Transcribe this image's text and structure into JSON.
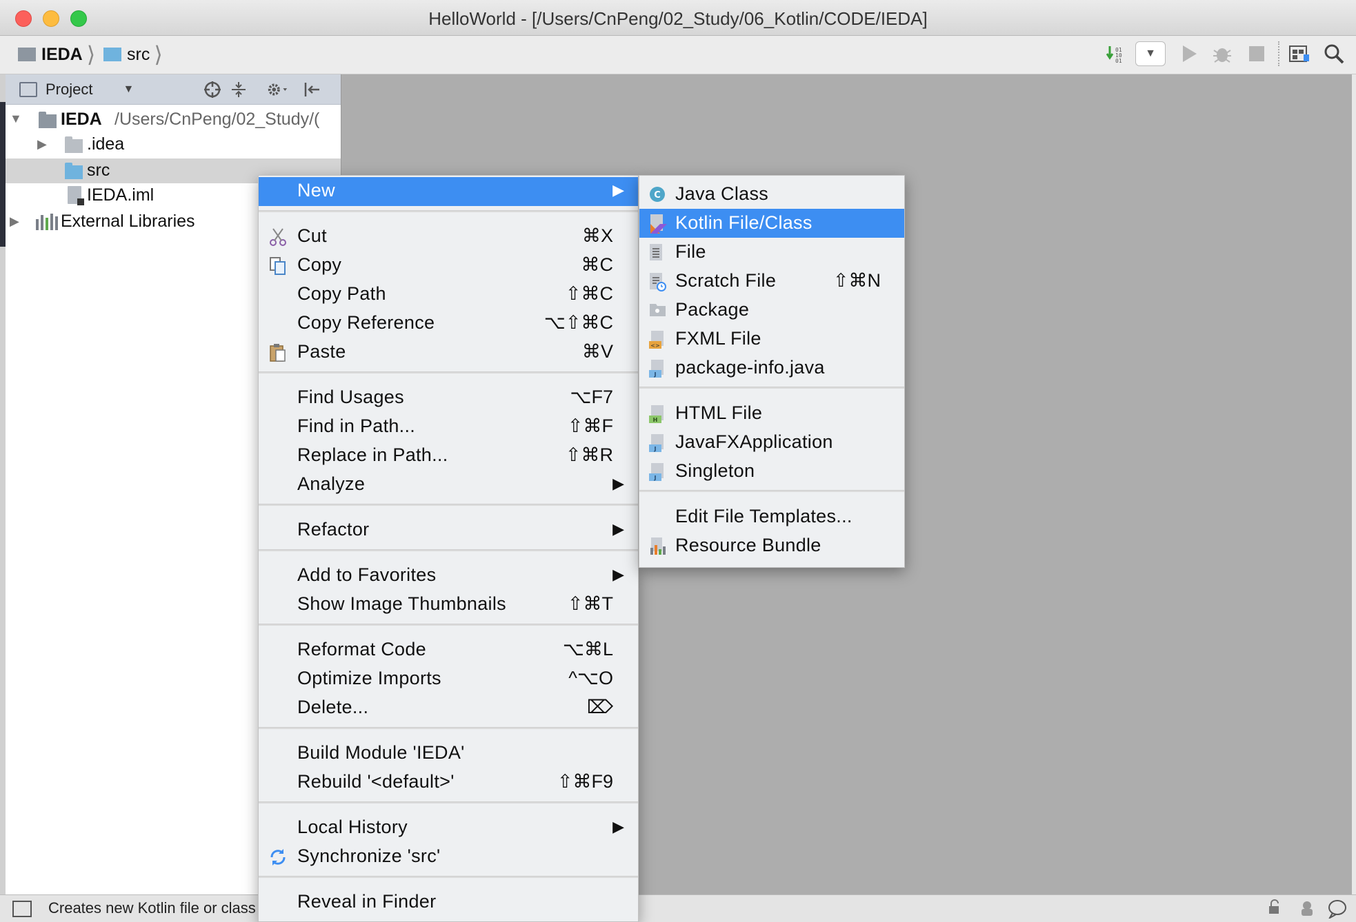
{
  "window": {
    "title": "HelloWorld - [/Users/CnPeng/02_Study/06_Kotlin/CODE/IEDA]"
  },
  "breadcrumb": {
    "items": [
      {
        "label": "IEDA",
        "icon": "module-folder-icon"
      },
      {
        "label": "src",
        "icon": "source-folder-icon"
      }
    ],
    "separator": "⟩"
  },
  "toolbar": {
    "icons": [
      "make-icon",
      "run-config-dropdown-icon",
      "run-icon",
      "debug-icon",
      "stop-icon",
      "project-structure-icon",
      "search-icon"
    ]
  },
  "project_panel": {
    "title": "Project",
    "tree": [
      {
        "name": "IEDA",
        "path": "/Users/CnPeng/02_Study/(",
        "expanded": true
      },
      {
        "name": ".idea",
        "expanded": false
      },
      {
        "name": "src",
        "selected": true
      },
      {
        "name": "IEDA.iml"
      },
      {
        "name": "External Libraries",
        "expanded": false
      }
    ]
  },
  "status_bar": {
    "text": "Creates new Kotlin file or class"
  },
  "context_menu": {
    "items": {
      "new": {
        "label": "New",
        "submenu": "▶"
      },
      "cut": {
        "label": "Cut",
        "shortcut": "⌘X",
        "icon": "scissors-icon"
      },
      "copy": {
        "label": "Copy",
        "shortcut": "⌘C",
        "icon": "copy-icon"
      },
      "copy_path": {
        "label": "Copy Path",
        "shortcut": "⇧⌘C"
      },
      "copy_reference": {
        "label": "Copy Reference",
        "shortcut": "⌥⇧⌘C"
      },
      "paste": {
        "label": "Paste",
        "shortcut": "⌘V",
        "icon": "clipboard-icon"
      },
      "find_usages": {
        "label": "Find Usages",
        "shortcut": "⌥F7"
      },
      "find_in_path": {
        "label": "Find in Path...",
        "shortcut": "⇧⌘F"
      },
      "replace_in_path": {
        "label": "Replace in Path...",
        "shortcut": "⇧⌘R"
      },
      "analyze": {
        "label": "Analyze",
        "submenu": "▶"
      },
      "refactor": {
        "label": "Refactor",
        "submenu": "▶"
      },
      "add_to_favorites": {
        "label": "Add to Favorites",
        "submenu": "▶"
      },
      "show_image_thumbnails": {
        "label": "Show Image Thumbnails",
        "shortcut": "⇧⌘T"
      },
      "reformat_code": {
        "label": "Reformat Code",
        "shortcut": "⌥⌘L"
      },
      "optimize_imports": {
        "label": "Optimize Imports",
        "shortcut": "^⌥O"
      },
      "delete": {
        "label": "Delete...",
        "shortcut": "⌦"
      },
      "build_module": {
        "label": "Build Module 'IEDA'"
      },
      "rebuild": {
        "label": "Rebuild '<default>'",
        "shortcut": "⇧⌘F9"
      },
      "local_history": {
        "label": "Local History",
        "submenu": "▶"
      },
      "synchronize": {
        "label": "Synchronize 'src'",
        "icon": "sync-icon"
      },
      "reveal_in_finder": {
        "label": "Reveal in Finder"
      }
    }
  },
  "new_submenu": {
    "items": {
      "java_class": {
        "label": "Java Class",
        "icon": "java-class-icon"
      },
      "kotlin_file": {
        "label": "Kotlin File/Class",
        "icon": "kotlin-file-icon",
        "highlighted": true
      },
      "file": {
        "label": "File",
        "icon": "text-file-icon"
      },
      "scratch_file": {
        "label": "Scratch File",
        "shortcut": "⇧⌘N",
        "icon": "scratch-file-icon"
      },
      "package": {
        "label": "Package",
        "icon": "package-icon"
      },
      "fxml_file": {
        "label": "FXML File",
        "icon": "fxml-file-icon"
      },
      "package_info": {
        "label": "package-info.java",
        "icon": "java-file-icon"
      },
      "html_file": {
        "label": "HTML File",
        "icon": "html-file-icon"
      },
      "javafx_app": {
        "label": "JavaFXApplication",
        "icon": "java-file-icon"
      },
      "singleton": {
        "label": "Singleton",
        "icon": "java-file-icon"
      },
      "edit_templates": {
        "label": "Edit File Templates..."
      },
      "resource_bundle": {
        "label": "Resource Bundle",
        "icon": "resource-bundle-icon"
      }
    }
  },
  "colors": {
    "highlight": "#3d8ef2",
    "editor_bg": "#adadad",
    "menu_bg": "#eef0f2"
  }
}
